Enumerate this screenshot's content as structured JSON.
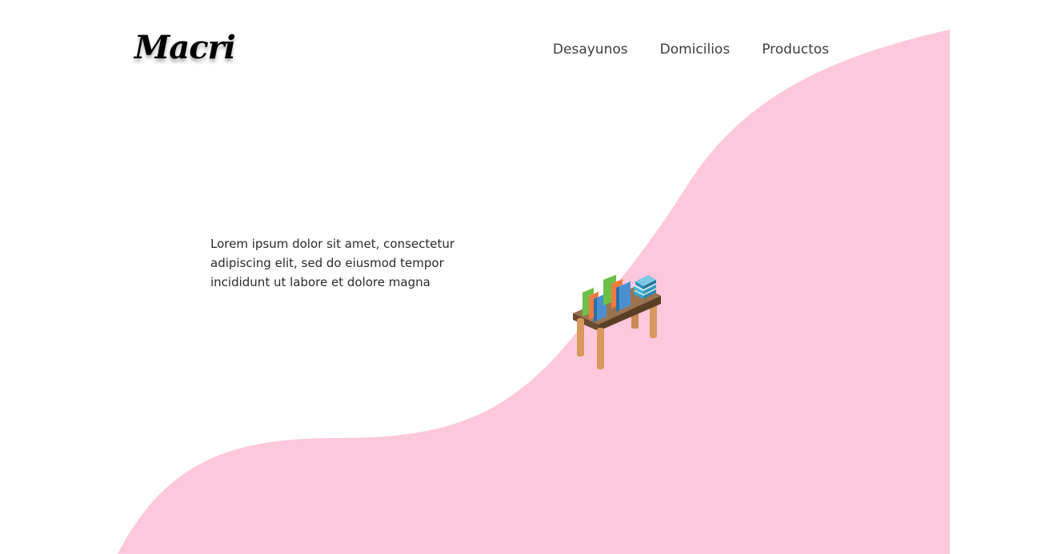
{
  "brand": {
    "logo_text": "Macri"
  },
  "nav": {
    "items": [
      {
        "label": "Desayunos"
      },
      {
        "label": "Domicilios"
      },
      {
        "label": "Productos"
      }
    ]
  },
  "hero": {
    "text": "Lorem ipsum dolor sit amet, consectetur adipiscing elit, sed do eiusmod tempor incididunt ut labore et dolore magna",
    "illustration_icon": "bookshelf-table-icon"
  },
  "colors": {
    "blob": "#fec8dc",
    "background": "#ffffff",
    "nav_text": "#3d3d3d",
    "body_text": "#2a2a2a"
  }
}
